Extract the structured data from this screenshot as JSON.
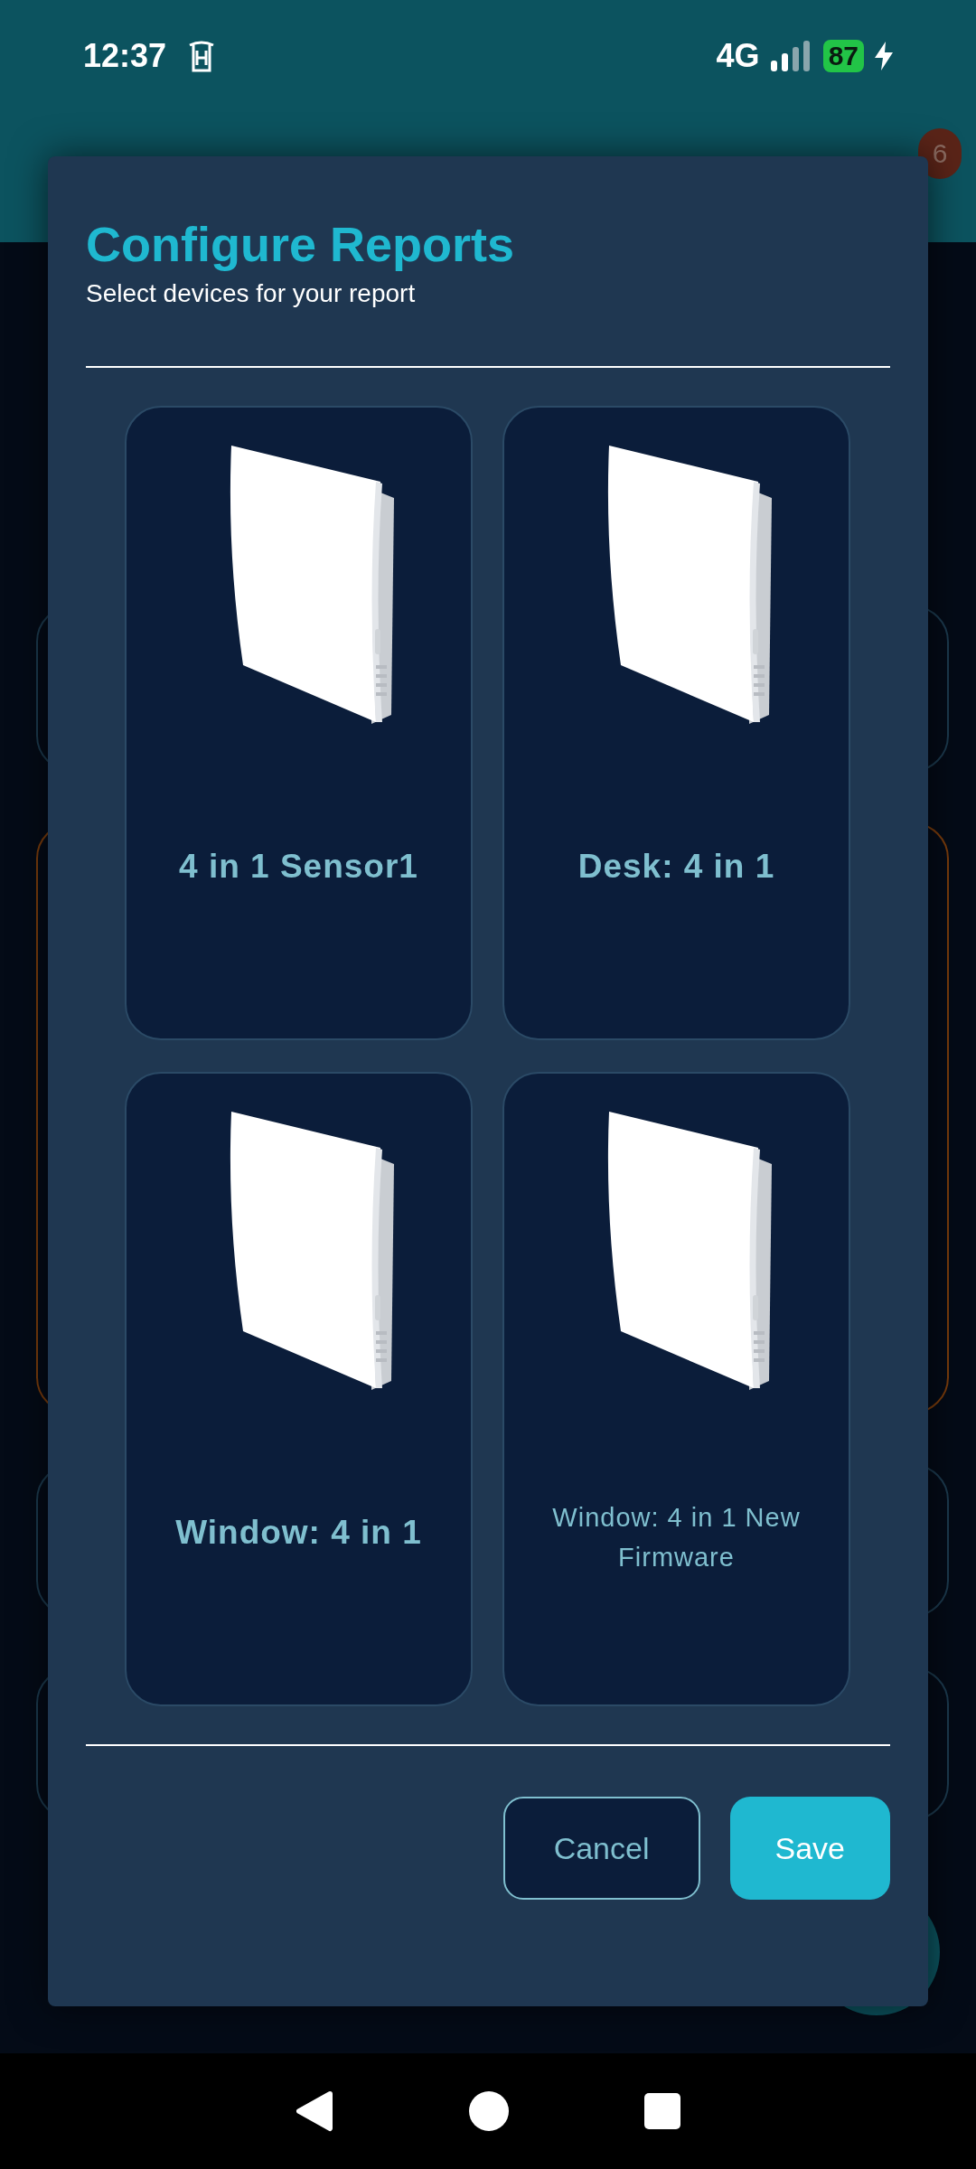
{
  "status_bar": {
    "time": "12:37",
    "network": "4G",
    "battery": "87"
  },
  "header": {
    "badge": "6"
  },
  "dialog": {
    "title": "Configure Reports",
    "subtitle": "Select devices for your report",
    "devices": [
      {
        "label": "4 in 1 Sensor1",
        "compact": false
      },
      {
        "label": "Desk: 4 in 1",
        "compact": false
      },
      {
        "label": "Window: 4 in 1",
        "compact": false
      },
      {
        "label": "Window: 4 in 1 New Firmware",
        "compact": true
      }
    ],
    "buttons": [
      {
        "label": "Cancel",
        "kind": "outline"
      },
      {
        "label": "Save",
        "kind": "primary"
      }
    ]
  }
}
